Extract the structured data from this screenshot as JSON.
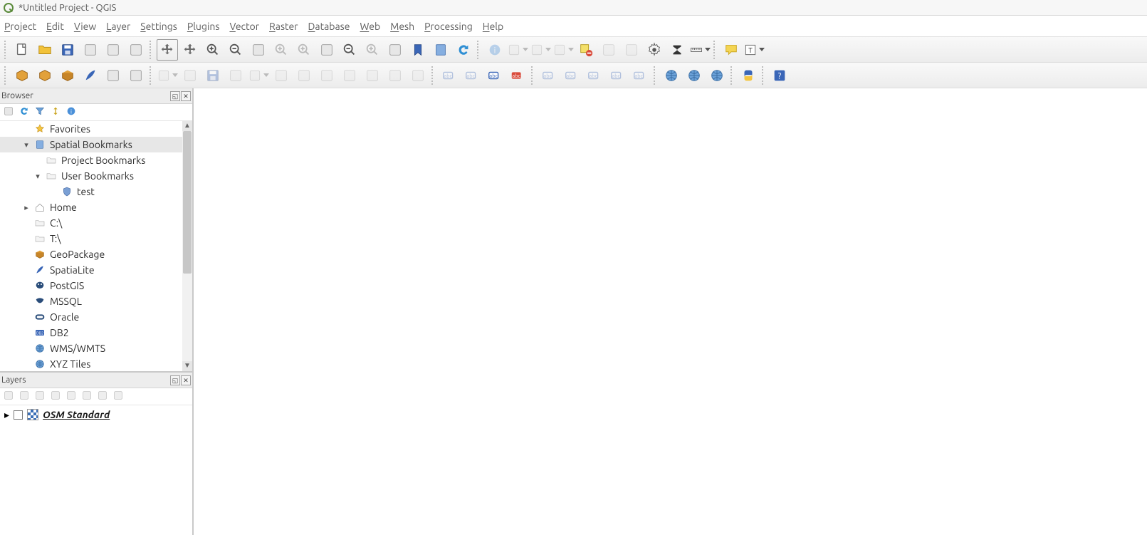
{
  "title": "*Untitled Project - QGIS",
  "menus": [
    "Project",
    "Edit",
    "View",
    "Layer",
    "Settings",
    "Plugins",
    "Vector",
    "Raster",
    "Database",
    "Web",
    "Mesh",
    "Processing",
    "Help"
  ],
  "toolbar1": [
    {
      "n": "new-project",
      "t": "doc-new"
    },
    {
      "n": "open-project",
      "t": "folder"
    },
    {
      "n": "save-project",
      "t": "save"
    },
    {
      "n": "new-print-layout",
      "t": "layout"
    },
    {
      "n": "show-layout-manager",
      "t": "layout-mgr"
    },
    {
      "n": "style-manager",
      "t": "style"
    },
    {
      "sep": true
    },
    {
      "n": "pan-map",
      "t": "pan",
      "sel": true
    },
    {
      "n": "pan-to-selection",
      "t": "pan-sel"
    },
    {
      "n": "zoom-in",
      "t": "zoom-in"
    },
    {
      "n": "zoom-out",
      "t": "zoom-out"
    },
    {
      "n": "zoom-full",
      "t": "zoom-full"
    },
    {
      "n": "zoom-selection",
      "t": "zoom-sel",
      "dim": true
    },
    {
      "n": "zoom-layer",
      "t": "zoom-lyr",
      "dim": true
    },
    {
      "n": "zoom-native",
      "t": "zoom-native"
    },
    {
      "n": "zoom-last",
      "t": "zoom-last"
    },
    {
      "n": "zoom-next",
      "t": "zoom-next",
      "dim": true
    },
    {
      "n": "new-map-view",
      "t": "new-map"
    },
    {
      "n": "new-bookmark",
      "t": "bookmark"
    },
    {
      "n": "show-bookmarks",
      "t": "bookmarks"
    },
    {
      "n": "refresh",
      "t": "refresh"
    },
    {
      "sep": true
    },
    {
      "n": "identify",
      "t": "identify",
      "dim": true
    },
    {
      "n": "action",
      "t": "action",
      "dim": true,
      "caret": true
    },
    {
      "n": "select-features",
      "t": "select",
      "dim": true,
      "caret": true
    },
    {
      "n": "select-value",
      "t": "select-val",
      "dim": true,
      "caret": true
    },
    {
      "n": "deselect",
      "t": "deselect"
    },
    {
      "n": "attr-table",
      "t": "attr",
      "dim": true
    },
    {
      "n": "field-calc",
      "t": "fieldcalc",
      "dim": true
    },
    {
      "n": "toolbox",
      "t": "gear"
    },
    {
      "n": "stats",
      "t": "sigma"
    },
    {
      "n": "measure",
      "t": "measure",
      "caret": true
    },
    {
      "sep": true
    },
    {
      "n": "map-tips",
      "t": "tip"
    },
    {
      "n": "text-annotation",
      "t": "text-ann",
      "caret": true
    }
  ],
  "toolbar2": [
    {
      "n": "add-vector-layer",
      "t": "vec"
    },
    {
      "n": "new-shapefile",
      "t": "new-shp"
    },
    {
      "n": "new-geopackage",
      "t": "gpkg"
    },
    {
      "n": "new-spatialite",
      "t": "spatialite"
    },
    {
      "n": "new-temp-scratch",
      "t": "temp"
    },
    {
      "n": "new-virtual",
      "t": "virt"
    },
    {
      "sep": true
    },
    {
      "n": "current-edits",
      "t": "edits",
      "dim": true,
      "caret": true
    },
    {
      "n": "toggle-edit",
      "t": "toggle",
      "dim": true
    },
    {
      "n": "save-edits",
      "t": "save-ed",
      "dim": true
    },
    {
      "n": "add-feature",
      "t": "add-feat",
      "dim": true
    },
    {
      "n": "move-feature",
      "t": "move",
      "dim": true,
      "caret": true
    },
    {
      "n": "node-tool",
      "t": "node",
      "dim": true
    },
    {
      "n": "delete-selected",
      "t": "del",
      "dim": true
    },
    {
      "n": "cut-features",
      "t": "cut",
      "dim": true
    },
    {
      "n": "copy-features",
      "t": "copy",
      "dim": true
    },
    {
      "n": "paste-features",
      "t": "paste",
      "dim": true
    },
    {
      "n": "undo",
      "t": "undo",
      "dim": true
    },
    {
      "n": "redo",
      "t": "redo",
      "dim": true
    },
    {
      "sep": true
    },
    {
      "n": "label-none",
      "t": "lbl-none",
      "dim": true
    },
    {
      "n": "label-diagram",
      "t": "lbl-diag",
      "dim": true
    },
    {
      "n": "label-layer",
      "t": "lbl-lyr"
    },
    {
      "n": "label-rule",
      "t": "lbl-rule"
    },
    {
      "sep": true
    },
    {
      "n": "label-pin",
      "t": "lbl-pin",
      "dim": true
    },
    {
      "n": "label-highlight",
      "t": "lbl-hi",
      "dim": true
    },
    {
      "n": "label-move",
      "t": "lbl-move",
      "dim": true
    },
    {
      "n": "label-rotate",
      "t": "lbl-rot",
      "dim": true
    },
    {
      "n": "label-change",
      "t": "lbl-chg",
      "dim": true
    },
    {
      "sep": true
    },
    {
      "n": "metasearch",
      "t": "globe1"
    },
    {
      "n": "web-wms",
      "t": "globe2"
    },
    {
      "n": "web-search",
      "t": "globe3"
    },
    {
      "sep": true
    },
    {
      "n": "python-console",
      "t": "python"
    },
    {
      "sep": true
    },
    {
      "n": "help",
      "t": "help"
    }
  ],
  "browser": {
    "title": "Browser",
    "toolbar": [
      "add-layer-icon",
      "refresh-icon",
      "filter-icon",
      "collapse-icon",
      "properties-icon"
    ],
    "tree": [
      {
        "lbl": "Favorites",
        "ico": "star",
        "ind": 1
      },
      {
        "lbl": "Spatial Bookmarks",
        "ico": "book",
        "ind": 1,
        "sel": true,
        "exp": "▾"
      },
      {
        "lbl": "Project Bookmarks",
        "ico": "folder",
        "ind": 2
      },
      {
        "lbl": "User Bookmarks",
        "ico": "folder",
        "ind": 2,
        "exp": "▾"
      },
      {
        "lbl": "test",
        "ico": "shield",
        "ind": 3
      },
      {
        "lbl": "Home",
        "ico": "home",
        "ind": 1,
        "exp": "▸"
      },
      {
        "lbl": "C:\\",
        "ico": "folder",
        "ind": 1
      },
      {
        "lbl": "T:\\",
        "ico": "folder",
        "ind": 1
      },
      {
        "lbl": "GeoPackage",
        "ico": "gpkg",
        "ind": 1
      },
      {
        "lbl": "SpatiaLite",
        "ico": "feather",
        "ind": 1
      },
      {
        "lbl": "PostGIS",
        "ico": "pg",
        "ind": 1
      },
      {
        "lbl": "MSSQL",
        "ico": "mssql",
        "ind": 1
      },
      {
        "lbl": "Oracle",
        "ico": "oracle",
        "ind": 1
      },
      {
        "lbl": "DB2",
        "ico": "db2",
        "ind": 1
      },
      {
        "lbl": "WMS/WMTS",
        "ico": "globe",
        "ind": 1
      },
      {
        "lbl": "XYZ Tiles",
        "ico": "globe",
        "ind": 1,
        "clip": true
      }
    ]
  },
  "layers": {
    "title": "Layers",
    "toolbar": [
      "open-style-icon",
      "add-group-icon",
      "manage-visibility-icon",
      "filter-legend-icon",
      "expand-icon",
      "expand-all-icon",
      "collapse-all-icon",
      "remove-icon"
    ],
    "items": [
      {
        "name": "OSM Standard"
      }
    ]
  }
}
